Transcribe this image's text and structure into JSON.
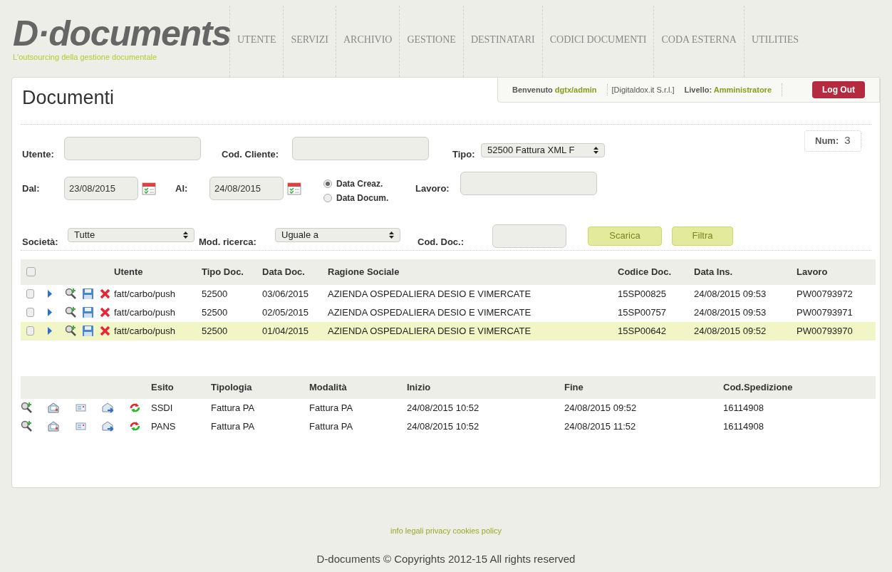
{
  "logo": {
    "name": "D·documents",
    "tagline": "L'outsourcing della gestione documentale"
  },
  "nav": [
    "UTENTE",
    "SERVIZI",
    "ARCHIVIO",
    "GESTIONE",
    "DESTINATARI",
    "CODICI DOCUMENTI",
    "CODA ESTERNA",
    "UTILITIES"
  ],
  "page_title": "Documenti",
  "user_bar": {
    "welcome_label": "Benvenuto",
    "user": "dgtx/admin",
    "company": "[Digitaldox.it S.r.l.]",
    "level_label": "Livello:",
    "level": "Amministratore",
    "logout": "Log Out"
  },
  "num": {
    "label": "Num:",
    "value": "3"
  },
  "filters": {
    "utente": {
      "label": "Utente:"
    },
    "cod_cliente": {
      "label": "Cod. Cliente:"
    },
    "tipo": {
      "label": "Tipo:",
      "value": "52500 Fattura XML F"
    },
    "dal": {
      "label": "Dal:",
      "value": "23/08/2015"
    },
    "al": {
      "label": "Al:",
      "value": "24/08/2015"
    },
    "date_mode": [
      {
        "label": "Data Creaz.",
        "selected": true
      },
      {
        "label": "Data Docum.",
        "selected": false
      }
    ],
    "lavoro": {
      "label": "Lavoro:"
    },
    "societa": {
      "label": "Società:",
      "value": "Tutte"
    },
    "mod_ricerca": {
      "label": "Mod. ricerca:",
      "value": "Uguale a"
    },
    "cod_doc": {
      "label": "Cod. Doc.:"
    },
    "buttons": [
      "Scarica",
      "Filtra"
    ]
  },
  "documents": {
    "all_checked": false,
    "columns": [
      "Utente",
      "Tipo Doc.",
      "Data Doc.",
      "Ragione Sociale",
      "Codice Doc.",
      "Data Ins.",
      "Lavoro"
    ],
    "rows": [
      {
        "checked": false,
        "selected": false,
        "cells": [
          "fatt/carbo/push",
          "52500",
          "03/06/2015",
          "AZIENDA OSPEDALIERA DESIO E VIMERCATE",
          "15SP00825",
          "24/08/2015 09:53",
          "PW00793972"
        ]
      },
      {
        "checked": false,
        "selected": false,
        "cells": [
          "fatt/carbo/push",
          "52500",
          "02/05/2015",
          "AZIENDA OSPEDALIERA DESIO E VIMERCATE",
          "15SP00757",
          "24/08/2015 09:53",
          "PW00793971"
        ]
      },
      {
        "checked": false,
        "selected": true,
        "cells": [
          "fatt/carbo/push",
          "52500",
          "01/04/2015",
          "AZIENDA OSPEDALIERA DESIO E VIMERCATE",
          "15SP00642",
          "24/08/2015 09:52",
          "PW00793970"
        ]
      }
    ]
  },
  "shipments": {
    "columns": [
      "Esito",
      "Tipologia",
      "Modalità",
      "Inizio",
      "Fine",
      "Cod.Spedizione"
    ],
    "rows": [
      {
        "cells": [
          "SSDI",
          "Fattura PA",
          "Fattura PA",
          "24/08/2015 10:52",
          "24/08/2015 09:52",
          "16114908"
        ]
      },
      {
        "cells": [
          "PANS",
          "Fattura PA",
          "Fattura PA",
          "24/08/2015 10:52",
          "24/08/2015 11:52",
          "16114908"
        ]
      }
    ]
  },
  "footer": {
    "links": "info legali privacy cookies policy",
    "copyright": "D-documents © Copyrights 2012-15 All rights reserved"
  }
}
